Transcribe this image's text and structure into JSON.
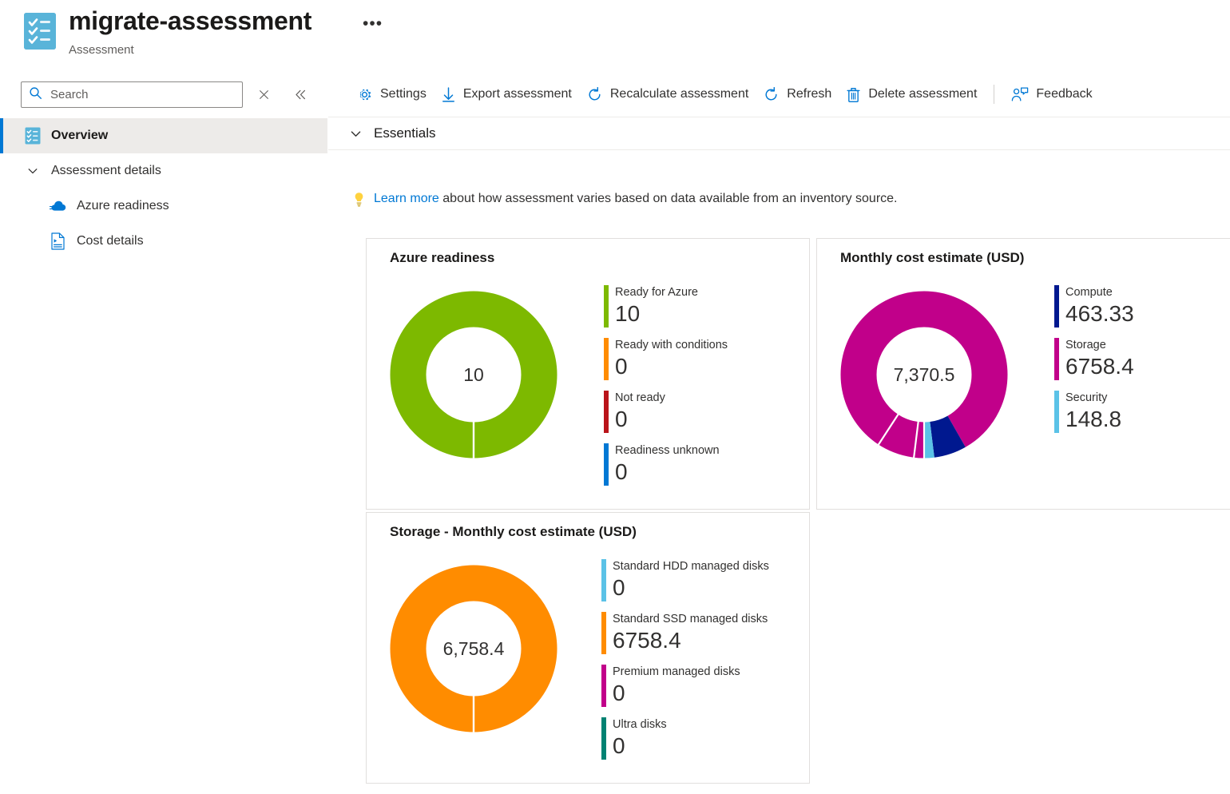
{
  "header": {
    "title": "migrate-assessment",
    "subtitle": "Assessment",
    "icon": "assessment-checklist-icon",
    "more_label": "•••"
  },
  "search": {
    "placeholder": "Search",
    "value": "",
    "icon": "search-icon",
    "clear_icon": "close-icon",
    "collapse_icon": "chevron-double-left-icon"
  },
  "sidebar": {
    "items": [
      {
        "label": "Overview",
        "icon": "assessment-checklist-icon",
        "active": true
      },
      {
        "label": "Assessment details",
        "icon": "chevron-down-icon",
        "group": true
      },
      {
        "label": "Azure readiness",
        "icon": "cloud-icon",
        "child": true
      },
      {
        "label": "Cost details",
        "icon": "document-icon",
        "child": true
      }
    ]
  },
  "toolbar": {
    "items": [
      {
        "label": "Settings",
        "icon": "gear-icon"
      },
      {
        "label": "Export assessment",
        "icon": "download-arrow-icon"
      },
      {
        "label": "Recalculate assessment",
        "icon": "refresh-circle-icon"
      },
      {
        "label": "Refresh",
        "icon": "refresh-circle-icon"
      },
      {
        "label": "Delete assessment",
        "icon": "trash-icon"
      }
    ],
    "feedback": {
      "label": "Feedback",
      "icon": "feedback-person-icon"
    }
  },
  "essentials": {
    "label": "Essentials",
    "icon": "chevron-down-icon"
  },
  "banner": {
    "icon": "lightbulb-icon",
    "link_text": "Learn more",
    "rest_text": " about how assessment varies based on data available from an inventory source."
  },
  "colors": {
    "accent": "#0078d4",
    "green": "#7db900",
    "orange": "#ff8c00",
    "red": "#ba141a",
    "blue": "#0078d4",
    "navy": "#00188f",
    "magenta": "#c1008a",
    "light_blue": "#5bc2e7",
    "teal": "#008272"
  },
  "chart_data": [
    {
      "type": "pie",
      "title": "Azure readiness",
      "center_label": "10",
      "total": 10,
      "categories": [
        "Ready for Azure",
        "Ready with conditions",
        "Not ready",
        "Readiness unknown"
      ],
      "values": [
        10,
        0,
        0,
        0
      ],
      "colors": [
        "#7db900",
        "#ff8c00",
        "#ba141a",
        "#0078d4"
      ],
      "legend": "right",
      "donut": true
    },
    {
      "type": "pie",
      "title": "Monthly cost estimate (USD)",
      "center_label": "7,370.5",
      "total": 7370.53,
      "categories": [
        "Compute",
        "Storage",
        "Security"
      ],
      "values": [
        463.33,
        6758.4,
        148.8
      ],
      "value_labels": [
        "463.33",
        "6758.4",
        "148.8"
      ],
      "colors": [
        "#00188f",
        "#c1008a",
        "#5bc2e7"
      ],
      "legend": "right",
      "donut": true
    },
    {
      "type": "pie",
      "title": "Storage - Monthly cost estimate (USD)",
      "center_label": "6,758.4",
      "total": 6758.4,
      "categories": [
        "Standard HDD managed disks",
        "Standard SSD managed disks",
        "Premium managed disks",
        "Ultra disks"
      ],
      "values": [
        0,
        6758.4,
        0,
        0
      ],
      "value_labels": [
        "0",
        "6758.4",
        "0",
        "0"
      ],
      "colors": [
        "#5bc2e7",
        "#ff8c00",
        "#c1008a",
        "#008272"
      ],
      "legend": "right",
      "donut": true
    }
  ]
}
